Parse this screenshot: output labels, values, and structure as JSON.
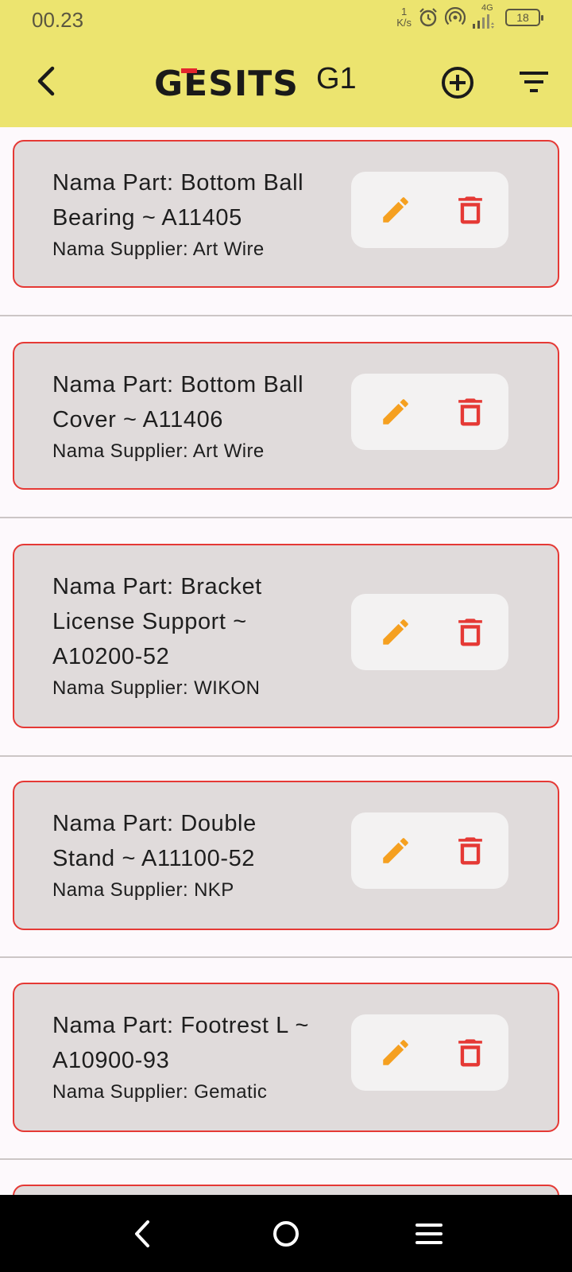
{
  "status_bar": {
    "time": "00.23",
    "net_speed_value": "1",
    "net_speed_unit": "K/s",
    "network_type": "4G",
    "battery": "18",
    "icons": [
      "alarm-icon",
      "hotspot-icon",
      "signal-icon"
    ]
  },
  "app_bar": {
    "logo_text": "GESITS",
    "variant": "G1",
    "icons": [
      "back-arrow-icon",
      "add-circle-icon",
      "filter-icon"
    ],
    "colors": {
      "background": "#ece46f",
      "logo_accent": "#e3262d"
    }
  },
  "parts": [
    {
      "name_lines": [
        "Nama Part: Bottom Ball",
        "Bearing ~ A11405"
      ],
      "supplier": "Nama Supplier: Art Wire"
    },
    {
      "name_lines": [
        "Nama Part: Bottom Ball",
        "Cover ~ A11406"
      ],
      "supplier": "Nama Supplier: Art Wire"
    },
    {
      "name_lines": [
        "Nama Part: Bracket",
        "License Support ~",
        "A10200-52"
      ],
      "supplier": "Nama Supplier: WIKON"
    },
    {
      "name_lines": [
        "Nama Part: Double",
        "Stand ~ A11100-52"
      ],
      "supplier": "Nama Supplier: NKP"
    },
    {
      "name_lines": [
        "Nama Part: Footrest L ~",
        "A10900-93"
      ],
      "supplier": "Nama Supplier: Gematic"
    }
  ],
  "card_icons": {
    "edit": "pencil-icon",
    "delete": "trash-icon"
  },
  "colors": {
    "card_bg": "#e0dbdb",
    "card_border": "#e53935",
    "edit": "#f5a020",
    "delete": "#e53935"
  },
  "nav_bar": {
    "icons": [
      "nav-back-icon",
      "nav-home-icon",
      "nav-menu-icon"
    ]
  }
}
